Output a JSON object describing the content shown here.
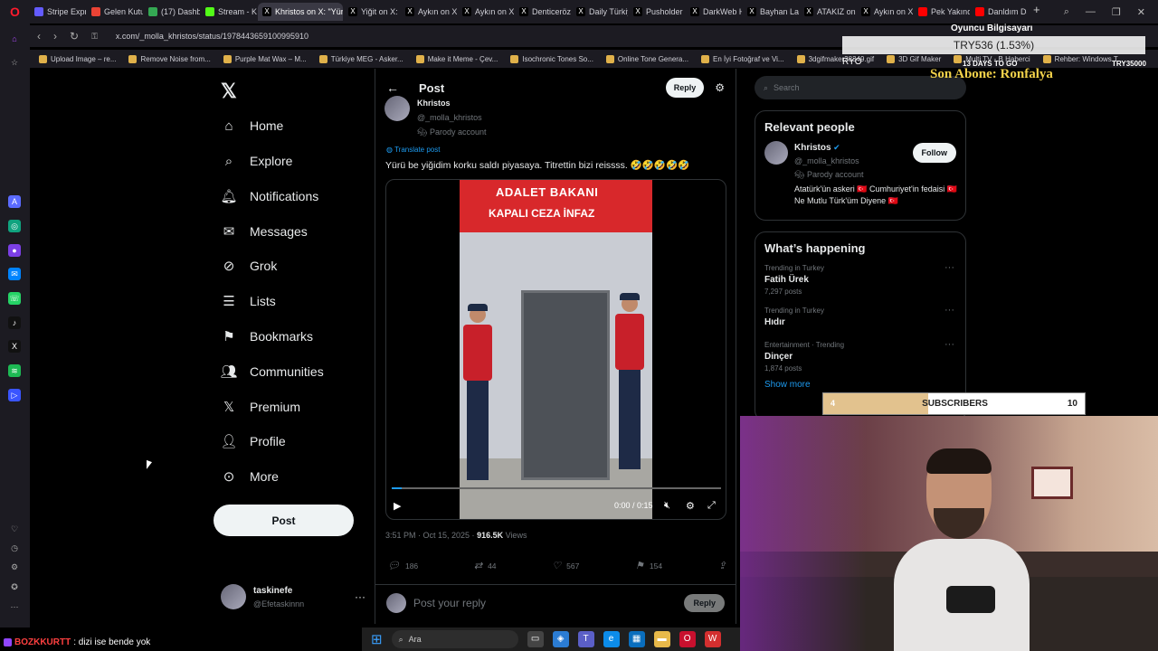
{
  "browser": {
    "tabs": [
      {
        "label": "Stripe Expre",
        "color": "#635bff"
      },
      {
        "label": "Gelen Kutu",
        "color": "#ea4335"
      },
      {
        "label": "(17) Dashb",
        "color": "#34a853"
      },
      {
        "label": "Stream - Ki",
        "color": "#53fc18"
      },
      {
        "label": "Khristos on X: \"Yürü",
        "color": "#000000",
        "active": true
      },
      {
        "label": "Yiğit on X: ",
        "color": "#000000"
      },
      {
        "label": "Aykın on X",
        "color": "#000000"
      },
      {
        "label": "Aykın on X",
        "color": "#000000"
      },
      {
        "label": "Denticeröz",
        "color": "#000000"
      },
      {
        "label": "Daily Türkiy",
        "color": "#000000"
      },
      {
        "label": "Pusholder",
        "color": "#000000"
      },
      {
        "label": "DarkWeb H",
        "color": "#000000"
      },
      {
        "label": "Bayhan Lak",
        "color": "#000000"
      },
      {
        "label": "ATAKIZ on",
        "color": "#000000"
      },
      {
        "label": "Aykın on X",
        "color": "#000000"
      },
      {
        "label": "Pek Yakında",
        "color": "#ff0000"
      },
      {
        "label": "Danldım Da",
        "color": "#ff0000"
      }
    ],
    "url": "x.com/_molla_khristos/status/1978443659100995910",
    "bookmarks": [
      "Upload Image – re...",
      "Remove Noise from...",
      "Purple Mat Wax – M...",
      "Türkiye MEG - Asker...",
      "Make it Meme - Çev...",
      "Isochronic Tones So...",
      "Online Tone Genera...",
      "En İyi Fotoğraf ve Vi...",
      "3dgifmaker28349.gif",
      "3D Gif Maker",
      "Multi TV - B Haberci",
      "Rehber: Windows T..."
    ]
  },
  "nav": {
    "home": "Home",
    "explore": "Explore",
    "notifications": "Notifications",
    "messages": "Messages",
    "grok": "Grok",
    "lists": "Lists",
    "bookmarks": "Bookmarks",
    "communities": "Communities",
    "premium": "Premium",
    "profile": "Profile",
    "more": "More",
    "post_button": "Post",
    "user_display": "taskinefe",
    "user_handle": "@Efetaskinnn"
  },
  "post": {
    "header_title": "Post",
    "reply_button": "Reply",
    "author_name": "Khristos",
    "author_handle": "@_molla_khristos",
    "author_badge": "Parody account",
    "translate": "Translate post",
    "text": "Yürü be yiğidim korku saldı piyasaya. Titrettin bizi reissss. 🤣🤣🤣🤣🤣",
    "video": {
      "sign_line1": "ADALET BAKANI",
      "sign_line2": "KAPALI CEZA İNFAZ",
      "time": "0:00 / 0:15",
      "progress": 0.03
    },
    "timestamp": "3:51 PM · Oct 15, 2025 · ",
    "views": "916.5K",
    "views_label": " Views",
    "replies": "186",
    "reposts": "44",
    "likes": "567",
    "bookmarks": "154",
    "reply_placeholder": "Post your reply",
    "reply_action": "Reply"
  },
  "right": {
    "search_placeholder": "Search",
    "relevant_title": "Relevant people",
    "person": {
      "name": "Khristos",
      "handle": "@_molla_khristos",
      "badge": "Parody account",
      "bio": "Atatürk'ün askeri 🇹🇷 Cumhuriyet'in fedaisi 🇹🇷 Ne Mutlu Türk'üm Diyene 🇹🇷",
      "follow": "Follow"
    },
    "happening_title": "What’s happening",
    "trends": [
      {
        "category": "Trending in Turkey",
        "name": "Fatih Ürek",
        "count": "7,297 posts"
      },
      {
        "category": "Trending in Turkey",
        "name": "Hıdır",
        "count": ""
      },
      {
        "category": "Entertainment · Trending",
        "name": "Dinçer",
        "count": "1,874 posts"
      }
    ],
    "show_more": "Show more"
  },
  "overlay": {
    "label": "Oyuncu Bilgisayarı",
    "price": "TRY536 (1.53%)",
    "sub": "RYO",
    "days": "13 DAYS TO GO",
    "goal_amount": "TRY35000",
    "son_abone": "Son Abone: Ronfalya",
    "subscribers_label": "SUBSCRIBERS",
    "subscribers_current": "4",
    "subscribers_goal": "10",
    "subscribers_fraction": 0.4
  },
  "chat": {
    "user": "BOZKKURTT",
    "message": ": dizi ise bende yok"
  },
  "taskbar": {
    "search": "Ara"
  }
}
